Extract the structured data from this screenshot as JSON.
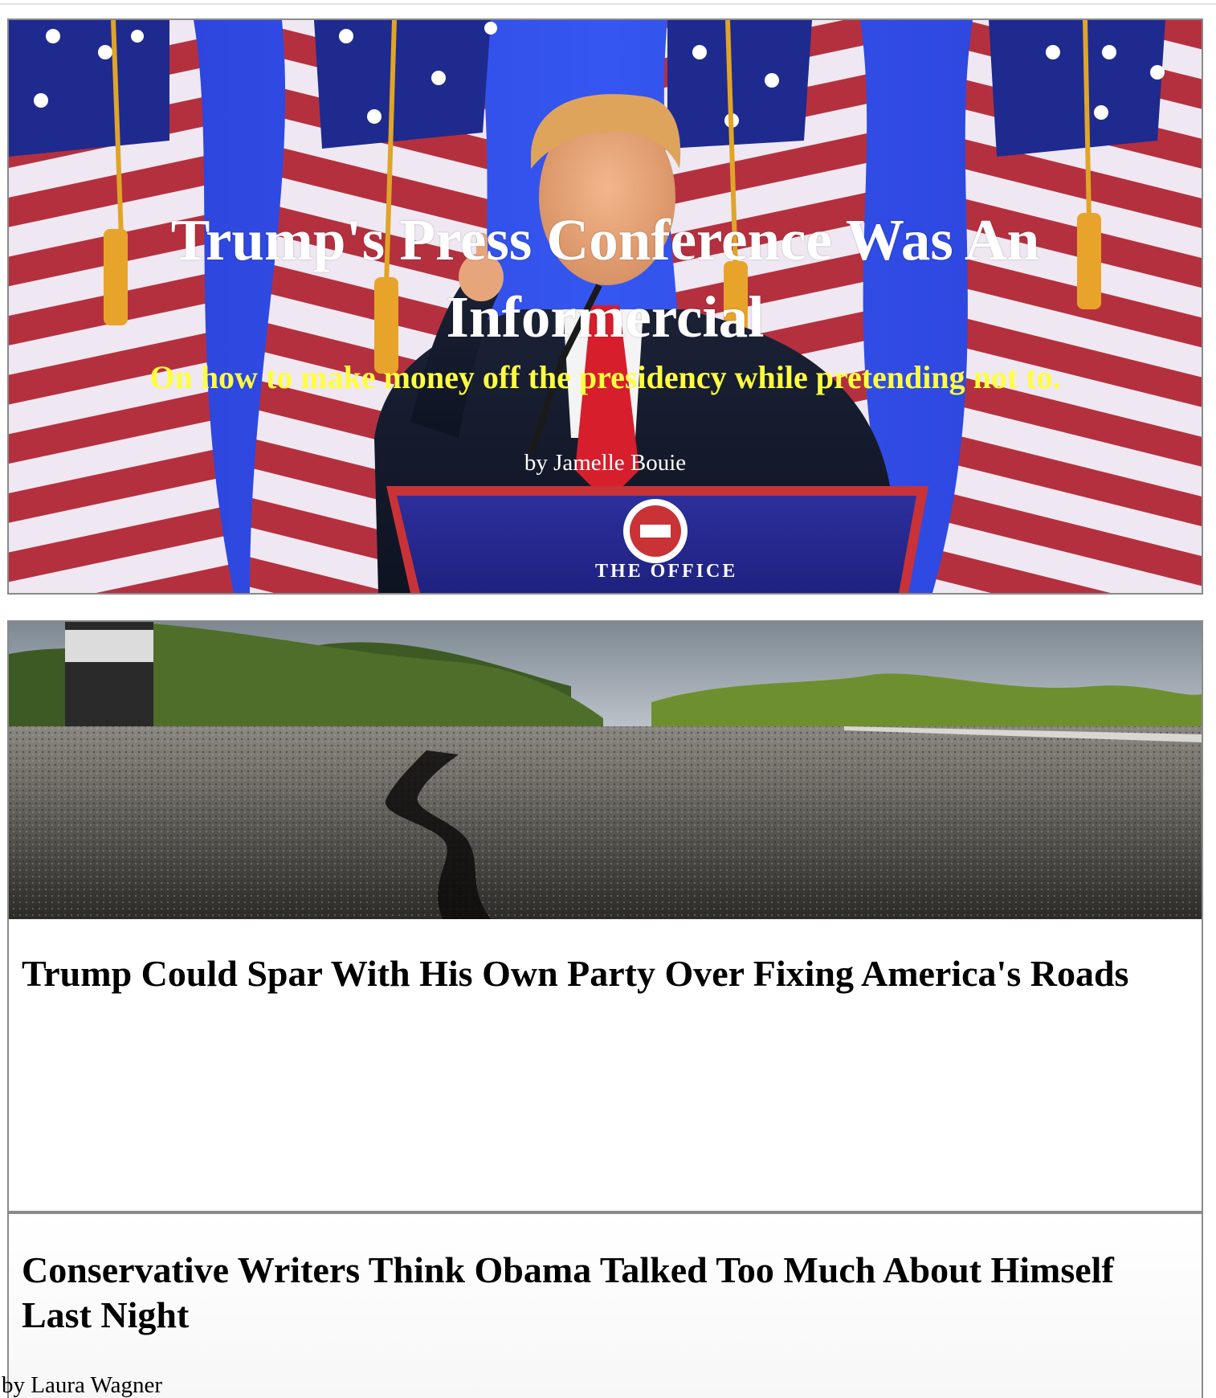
{
  "articles": {
    "featured": {
      "title": "Trump's Press Conference Was An Informercial",
      "subtitle": "On how to make money off the presidency while pretending not to.",
      "byline": "by Jamelle Bouie",
      "podium_text": "THE OFFICE"
    },
    "second": {
      "title": "Trump Could Spar With His Own Party Over Fixing America's Roads"
    },
    "third": {
      "title": "Conservative Writers Think Obama Talked Too Much About Himself Last Night",
      "byline": "by Laura Wagner"
    }
  },
  "colors": {
    "hero_title": "#ffffff",
    "hero_subtitle": "#ffff3f",
    "card_border": "#8a8a8a"
  }
}
